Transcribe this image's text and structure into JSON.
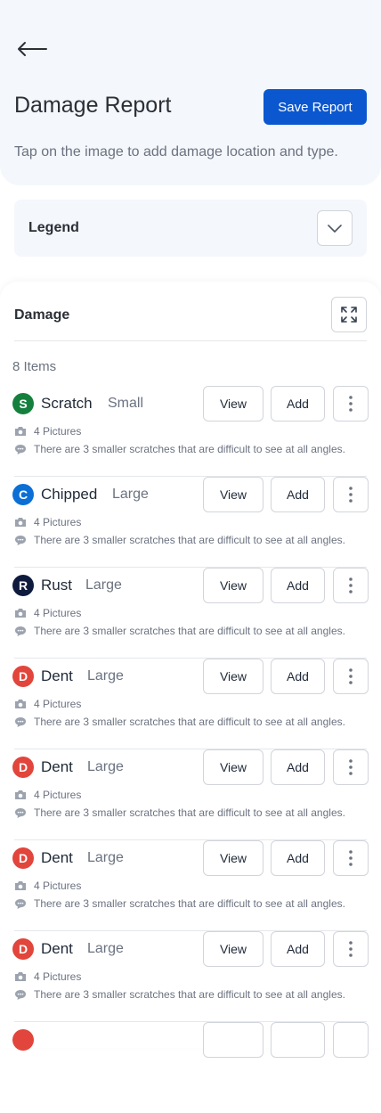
{
  "header": {
    "title": "Damage Report",
    "save_label": "Save Report",
    "subtitle": "Tap on the image to add damage location and type."
  },
  "legend": {
    "label": "Legend"
  },
  "damage": {
    "title": "Damage",
    "count_label": "8 Items",
    "view_label": "View",
    "add_label": "Add",
    "items": [
      {
        "initial": "S",
        "type": "Scratch",
        "size": "Small",
        "color": "#15803d",
        "pictures": "4 Pictures",
        "note": "There are 3 smaller scratches that are difficult to see at all angles."
      },
      {
        "initial": "C",
        "type": "Chipped",
        "size": "Large",
        "color": "#0b6fd6",
        "pictures": "4 Pictures",
        "note": "There are 3 smaller scratches that are difficult to see at all angles."
      },
      {
        "initial": "R",
        "type": "Rust",
        "size": "Large",
        "color": "#0f1b3d",
        "pictures": "4 Pictures",
        "note": "There are 3 smaller scratches that are difficult to see at all angles."
      },
      {
        "initial": "D",
        "type": "Dent",
        "size": "Large",
        "color": "#e2453b",
        "pictures": "4 Pictures",
        "note": "There are 3 smaller scratches that are difficult to see at all angles."
      },
      {
        "initial": "D",
        "type": "Dent",
        "size": "Large",
        "color": "#e2453b",
        "pictures": "4 Pictures",
        "note": "There are 3 smaller scratches that are difficult to see at all angles."
      },
      {
        "initial": "D",
        "type": "Dent",
        "size": "Large",
        "color": "#e2453b",
        "pictures": "4 Pictures",
        "note": "There are 3 smaller scratches that are difficult to see at all angles."
      },
      {
        "initial": "D",
        "type": "Dent",
        "size": "Large",
        "color": "#e2453b",
        "pictures": "4 Pictures",
        "note": "There are 3 smaller scratches that are difficult to see at all angles."
      },
      {
        "initial": "",
        "type": "",
        "size": "",
        "color": "#e2453b",
        "pictures": "",
        "note": ""
      }
    ]
  },
  "icons": {
    "back": "arrow-left-icon",
    "legend_toggle": "chevron-down-icon",
    "expand": "expand-icon",
    "more": "more-vertical-icon",
    "pictures": "camera-icon",
    "note": "comment-icon"
  }
}
